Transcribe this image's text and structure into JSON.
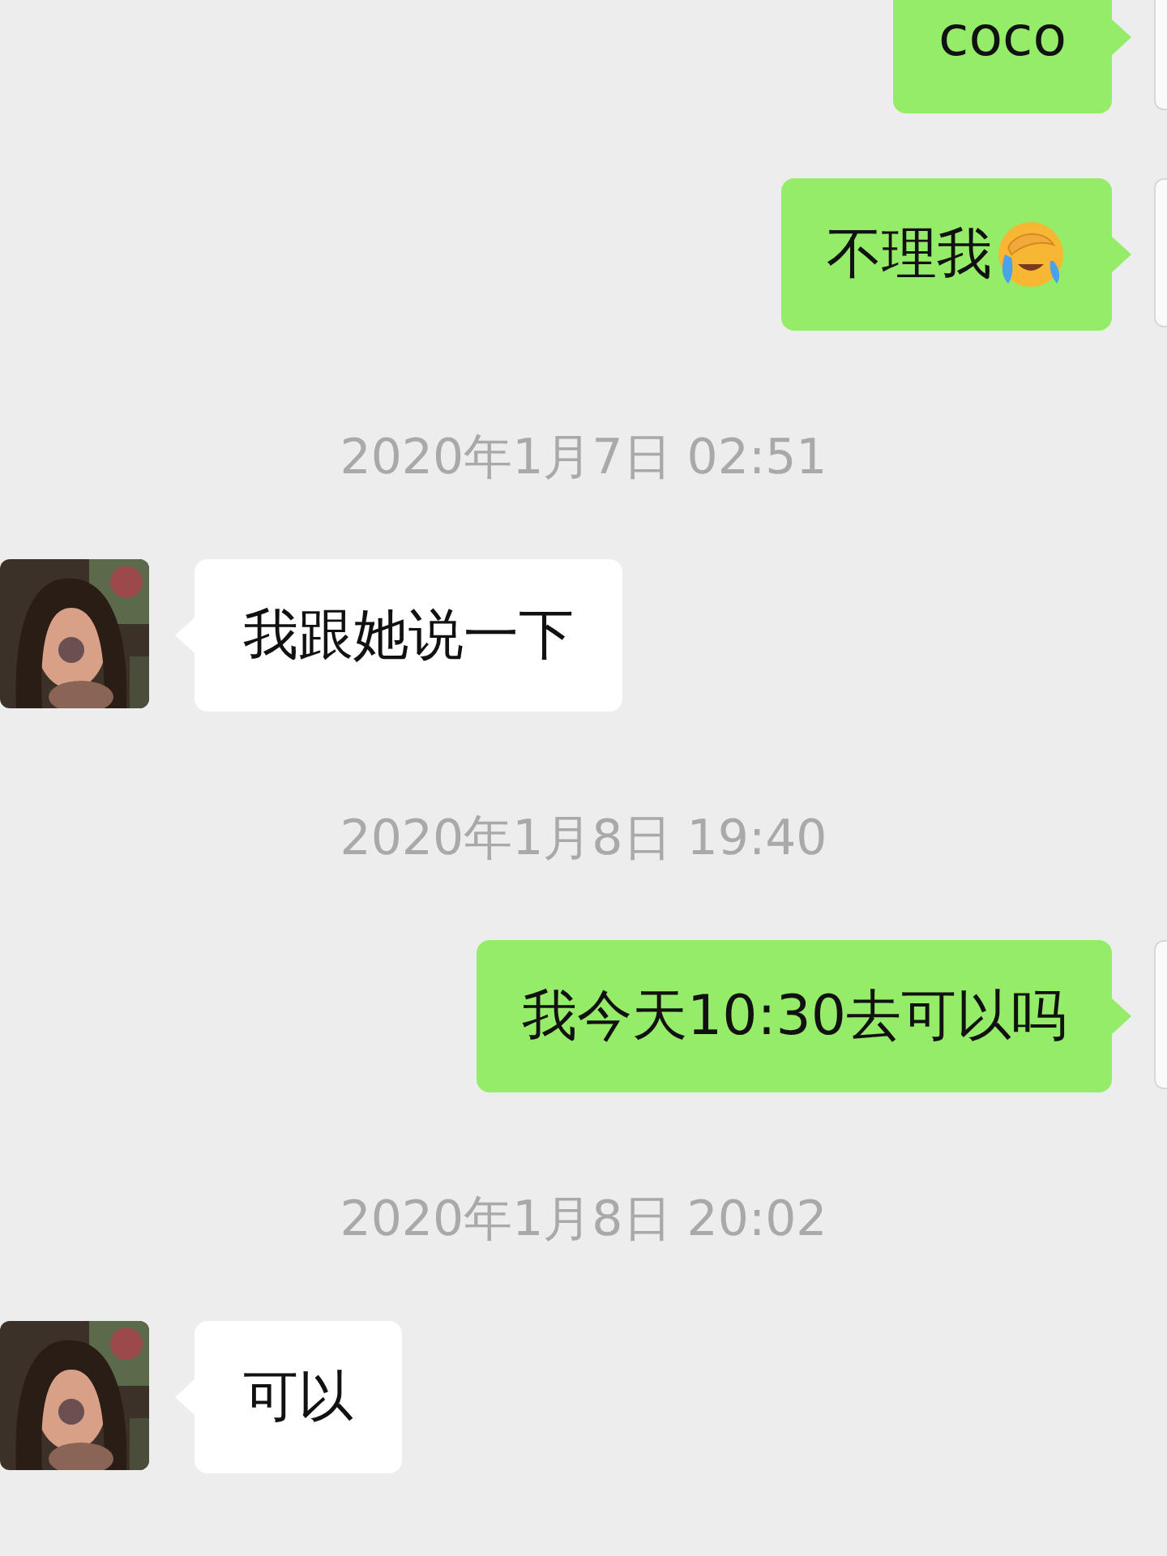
{
  "messages": [
    {
      "kind": "sent",
      "text": "coco"
    },
    {
      "kind": "sent",
      "text": "不理我",
      "emoji": true
    },
    {
      "kind": "time",
      "text": "2020年1月7日 02:51"
    },
    {
      "kind": "received",
      "text": "我跟她说一下"
    },
    {
      "kind": "time",
      "text": "2020年1月8日 19:40"
    },
    {
      "kind": "sent",
      "text": "我今天10:30去可以吗"
    },
    {
      "kind": "time",
      "text": "2020年1月8日 20:02"
    },
    {
      "kind": "received",
      "text": "可以"
    }
  ]
}
